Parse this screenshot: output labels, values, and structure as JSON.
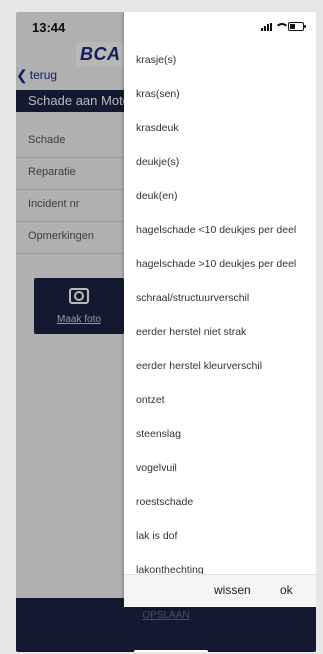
{
  "status": {
    "time": "13:44"
  },
  "app": {
    "logo": "BCA",
    "back_label": "terug",
    "title": "Schade aan Moto",
    "menu": [
      {
        "label": "Schade"
      },
      {
        "label": "Reparatie"
      },
      {
        "label": "Incident nr"
      },
      {
        "label": "Opmerkingen"
      }
    ],
    "photo_label": "Maak foto",
    "save_label": "OPSLAAN"
  },
  "picker": {
    "options": [
      "krasje(s)",
      "kras(sen)",
      "krasdeuk",
      "deukje(s)",
      "deuk(en)",
      "hagelschade <10 deukjes per deel",
      "hagelschade >10 deukjes per deel",
      "schraal/structuurverschil",
      "eerder herstel niet strak",
      "eerder herstel kleurverschil",
      "ontzet",
      "steenslag",
      "vogelvuil",
      "roestschade",
      "lak is dof",
      "lakonthechting"
    ],
    "clear_label": "wissen",
    "ok_label": "ok"
  },
  "colors": {
    "brand_navy": "#1b2344",
    "brand_blue": "#1b2a7a"
  },
  "icons": [
    "back-chevron-icon",
    "camera-icon",
    "signal-icon",
    "wifi-icon",
    "battery-icon"
  ]
}
